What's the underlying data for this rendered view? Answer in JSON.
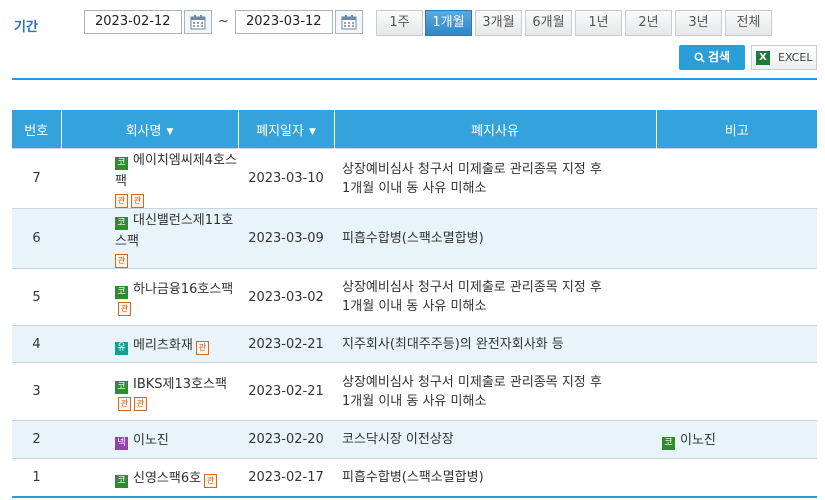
{
  "filter": {
    "label": "기간",
    "start_date": "2023-02-12",
    "end_date": "2023-03-12",
    "separator": "~",
    "periods": [
      "1주",
      "1개월",
      "3개월",
      "6개월",
      "1년",
      "2년",
      "3년",
      "전체"
    ],
    "active_period": "1개월",
    "search_label": "검색",
    "excel_label": "EXCEL",
    "excel_icon_text": "X"
  },
  "table": {
    "headers": {
      "no": "번호",
      "company": "회사명",
      "date": "폐지일자",
      "reason": "폐지사유",
      "note": "비고"
    },
    "sort_arrow": "▼",
    "rows": [
      {
        "no": "7",
        "market": "코",
        "company": "에이치엠씨제4호스팩",
        "badges": [
          "관",
          "관"
        ],
        "date": "2023-03-10",
        "reason_1": "상장예비심사 청구서 미제출로 관리종목 지정 후",
        "reason_2": "1개월 이내 동 사유 미해소",
        "note_market": "",
        "note": ""
      },
      {
        "no": "6",
        "market": "코",
        "company": "대신밸런스제11호스팩",
        "badges": [
          "관"
        ],
        "date": "2023-03-09",
        "reason_1": "피흡수합병(스팩소멸합병)",
        "reason_2": "",
        "note_market": "",
        "note": ""
      },
      {
        "no": "5",
        "market": "코",
        "company": "하나금융16호스팩",
        "badges": [
          "관"
        ],
        "date": "2023-03-02",
        "reason_1": "상장예비심사 청구서 미제출로 관리종목 지정 후",
        "reason_2": "1개월 이내 동 사유 미해소",
        "note_market": "",
        "note": ""
      },
      {
        "no": "4",
        "market": "유",
        "company": "메리츠화재",
        "badges": [
          "관"
        ],
        "date": "2023-02-21",
        "reason_1": "지주회사(최대주주등)의 완전자회사화 등",
        "reason_2": "",
        "note_market": "",
        "note": ""
      },
      {
        "no": "3",
        "market": "코",
        "company": "IBKS제13호스팩",
        "badges": [
          "관",
          "관"
        ],
        "date": "2023-02-21",
        "reason_1": "상장예비심사 청구서 미제출로 관리종목 지정 후",
        "reason_2": "1개월 이내 동 사유 미해소",
        "note_market": "",
        "note": ""
      },
      {
        "no": "2",
        "market": "넥",
        "company": "이노진",
        "badges": [],
        "date": "2023-02-20",
        "reason_1": "코스닥시장 이전상장",
        "reason_2": "",
        "note_market": "코",
        "note": "이노진"
      },
      {
        "no": "1",
        "market": "코",
        "company": "신영스팩6호",
        "badges": [
          "관"
        ],
        "date": "2023-02-17",
        "reason_1": "피흡수합병(스팩소멸합병)",
        "reason_2": "",
        "note_market": "",
        "note": ""
      }
    ]
  },
  "colors": {
    "accent": "#2a9ed8",
    "header_bg": "#34a3dc",
    "row_alt": "#e8f4fa",
    "kosdaq": "#2e8b2e",
    "kospi": "#1c9a94",
    "konex": "#8e44ad",
    "badge": "#d2691e"
  }
}
